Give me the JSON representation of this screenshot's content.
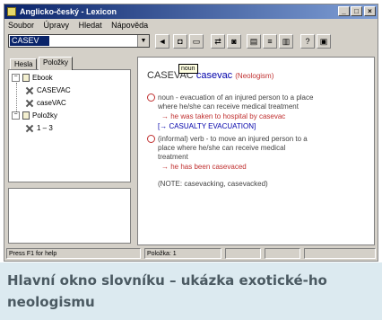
{
  "window": {
    "title": "Anglicko-český - Lexicon",
    "buttons": {
      "minimize": "_",
      "maximize": "□",
      "close": "×"
    }
  },
  "menu": [
    "Soubor",
    "Úpravy",
    "Hledat",
    "Nápověda"
  ],
  "search": {
    "value": "CASEV"
  },
  "tabs": {
    "contents": "Hesla",
    "favorites": "Položky"
  },
  "tree": {
    "root1": "Ebook",
    "items": [
      "CASEVAC",
      "caseVAC"
    ],
    "root2": "Položky",
    "root2_items": [
      "1 – 3"
    ]
  },
  "entry": {
    "headword": "CASEVAC",
    "translation": "casevac",
    "tag": "(Neologism)",
    "tooltip": "noun",
    "lines": [
      {
        "num": "1.",
        "style": "dark",
        "text": "noun - evacuation of an injured person to a place"
      },
      {
        "num": "",
        "style": "dark",
        "text": "where he/she can receive medical treatment"
      },
      {
        "num": "",
        "style": "red",
        "text": "→ he was taken to hospital by casevac"
      },
      {
        "num": "",
        "style": "blue",
        "text": "[→ CASUALTY EVACUATION]"
      },
      {
        "num": "2.",
        "style": "dark",
        "text": "(informal) verb - to move an injured person to a"
      },
      {
        "num": "",
        "style": "dark",
        "text": "place where he/she can receive medical"
      },
      {
        "num": "",
        "style": "dark",
        "text": "treatment"
      },
      {
        "num": "",
        "style": "red",
        "text": "→ he has been casevaced"
      },
      {
        "num": "",
        "style": "dark",
        "text": ""
      },
      {
        "num": "",
        "style": "dark",
        "text": "(NOTE: casevacking, casevacked)"
      }
    ]
  },
  "status": {
    "left": "Press F1 for help",
    "middle": "Položka: 1",
    "right": ""
  },
  "caption": "Hlavní okno slovníku – ukázka exotické-ho neologismu"
}
